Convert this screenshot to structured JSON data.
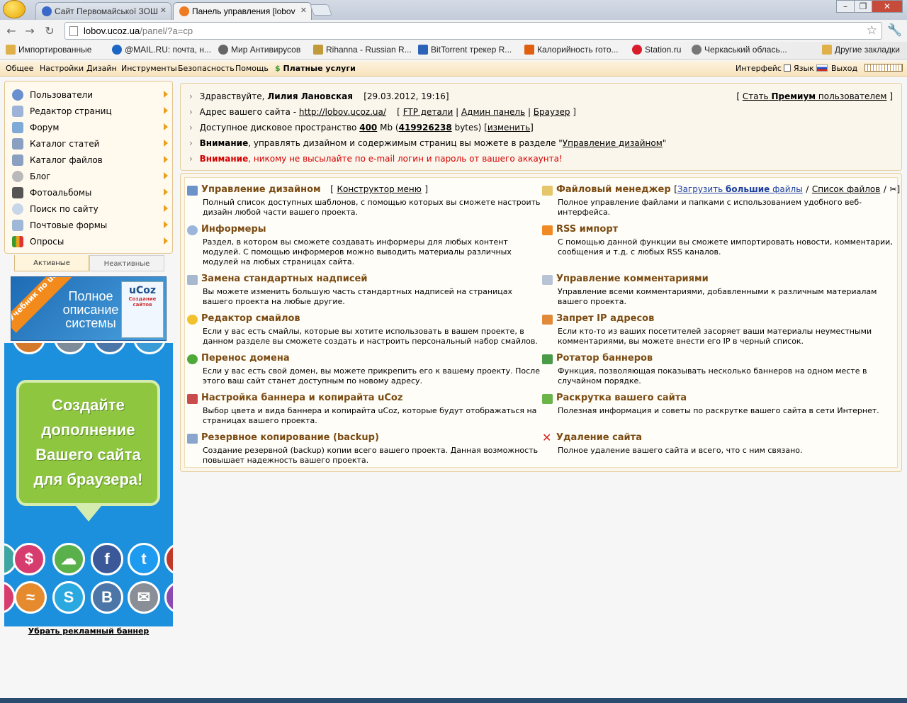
{
  "browser": {
    "tabs": [
      {
        "title": "Сайт Первомайської ЗОШ"
      },
      {
        "title": "Панель управления [lobov"
      }
    ],
    "url_host": "lobov.ucoz.ua",
    "url_path": "/panel/?a=cp",
    "bookmarks": [
      "Импортированные",
      "@MAIL.RU: почта, н...",
      "Мир Антивирусов",
      "Rihanna - Russian R...",
      "BitTorrent трекер R...",
      "Калорийность гото...",
      "Station.ru",
      "Черкаський облась...",
      "Другие закладки"
    ]
  },
  "topmenu": {
    "items": [
      "Общее",
      "Настройки",
      "Дизайн",
      "Инструменты",
      "Безопасность",
      "Помощь"
    ],
    "paid": "Платные услуги",
    "interface": "Интерфейс",
    "language": "Язык",
    "logout": "Выход"
  },
  "sidebar": {
    "items": [
      {
        "label": "Пользователи",
        "icon": "users-icon"
      },
      {
        "label": "Редактор страниц",
        "icon": "page-editor-icon"
      },
      {
        "label": "Форум",
        "icon": "forum-icon"
      },
      {
        "label": "Каталог статей",
        "icon": "articles-icon"
      },
      {
        "label": "Каталог файлов",
        "icon": "files-icon"
      },
      {
        "label": "Блог",
        "icon": "blog-icon"
      },
      {
        "label": "Фотоальбомы",
        "icon": "photo-icon"
      },
      {
        "label": "Поиск по сайту",
        "icon": "search-icon"
      },
      {
        "label": "Почтовые формы",
        "icon": "mail-form-icon"
      },
      {
        "label": "Опросы",
        "icon": "polls-icon"
      }
    ],
    "tab_active": "Активные",
    "tab_inactive": "Неактивные",
    "ad1": {
      "ribbon": "Учебник по uCoz",
      "text": "Полное описание системы",
      "brand": "uCoz",
      "brand_sub": "Создание сайтов"
    },
    "ad2": {
      "text": "Создайте дополнение Вашего сайта для браузера!"
    },
    "remove_ad": "Убрать рекламный баннер"
  },
  "welcome": {
    "hello": "Здравствуйте,",
    "user": "Лилия Лановская",
    "datetime": "[29.03.2012, 19:16]",
    "premium_pre": "[",
    "premium_link1": "Стать",
    "premium_bold": "Премиум",
    "premium_link2": "пользователем",
    "premium_post": "]",
    "address_label": "Адрес вашего сайта -",
    "address": "http://lobov.ucoz.ua/",
    "ftp": "FTP детали",
    "admin": "Админ панель",
    "browser": "Браузер",
    "space_label": "Доступное дисковое пространство",
    "space_value": "400",
    "space_unit": "Mb",
    "space_bytes": "419926238",
    "space_bytes_unit": "bytes)",
    "space_change": "изменить",
    "attention1_bold": "Внимание",
    "attention1_text": ", управлять дизайном и содержимым страниц вы можете в разделе \"",
    "attention1_link": "Управление дизайном",
    "attention1_end": "\"",
    "attention2_bold": "Внимание",
    "attention2_text": ", никому не высылайте по e-mail логин и пароль от вашего аккаунта!"
  },
  "features": {
    "left": [
      {
        "title": "Управление дизайном",
        "extra": "Конструктор меню",
        "desc": "Полный список доступных шаблонов, с помощью которых вы сможете настроить дизайн любой части вашего проекта."
      },
      {
        "title": "Информеры",
        "desc": "Раздел, в котором вы сможете создавать информеры для любых контент модулей. С помощью информеров можно выводить материалы различных модулей на любых страницах сайта."
      },
      {
        "title": "Замена стандартных надписей",
        "desc": "Вы можете изменить большую часть стандартных надписей на страницах вашего проекта на любые другие."
      },
      {
        "title": "Редактор смайлов",
        "desc": "Если у вас есть смайлы, которые вы хотите использовать в вашем проекте, в данном разделе вы сможете создать и настроить персональный набор смайлов."
      },
      {
        "title": "Перенос домена",
        "desc": "Если у вас есть свой домен, вы можете прикрепить его к вашему проекту. После этого ваш сайт станет доступным по новому адресу."
      },
      {
        "title": "Настройка баннера и копирайта uCoz",
        "desc": "Выбор цвета и вида баннера и копирайта uCoz, которые будут отображаться на страницах вашего проекта."
      },
      {
        "title": "Резервное копирование (backup)",
        "desc": "Создание резервной (backup) копии всего вашего проекта. Данная возможность повышает надежность вашего проекта."
      }
    ],
    "right": [
      {
        "title": "Файловый менеджер",
        "link1_pre": "Загрузить",
        "link1_bold": "большие",
        "link1_post": "файлы",
        "link2": "Список файлов",
        "desc": "Полное управление файлами и папками с использованием удобного веб-интерфейса."
      },
      {
        "title": "RSS импорт",
        "desc": "С помощью данной функции вы сможете импортировать новости, комментарии, сообщения и т.д. с любых RSS каналов."
      },
      {
        "title": "Управление комментариями",
        "desc": "Управление всеми комментариями, добавленными к различным материалам вашего проекта."
      },
      {
        "title": "Запрет IP адресов",
        "desc": "Если кто-то из ваших посетителей засоряет ваши материалы неуместными комментариями, вы можете внести его IP в черный список."
      },
      {
        "title": "Ротатор баннеров",
        "desc": "Функция, позволяющая показывать несколько баннеров на одном месте в случайном порядке."
      },
      {
        "title": "Раскрутка вашего сайта",
        "desc": "Полезная информация и советы по раскрутке вашего сайта в сети Интернет."
      },
      {
        "title": "Удаление сайта",
        "desc": "Полное удаление вашего сайта и всего, что с ним связано."
      }
    ]
  },
  "colors": {
    "accent": "#7a4b12",
    "menu_bg": "#f8e3bd",
    "warning": "#d40000",
    "ad_blue": "#1c8fdd",
    "ad_green": "#8fc63f"
  }
}
